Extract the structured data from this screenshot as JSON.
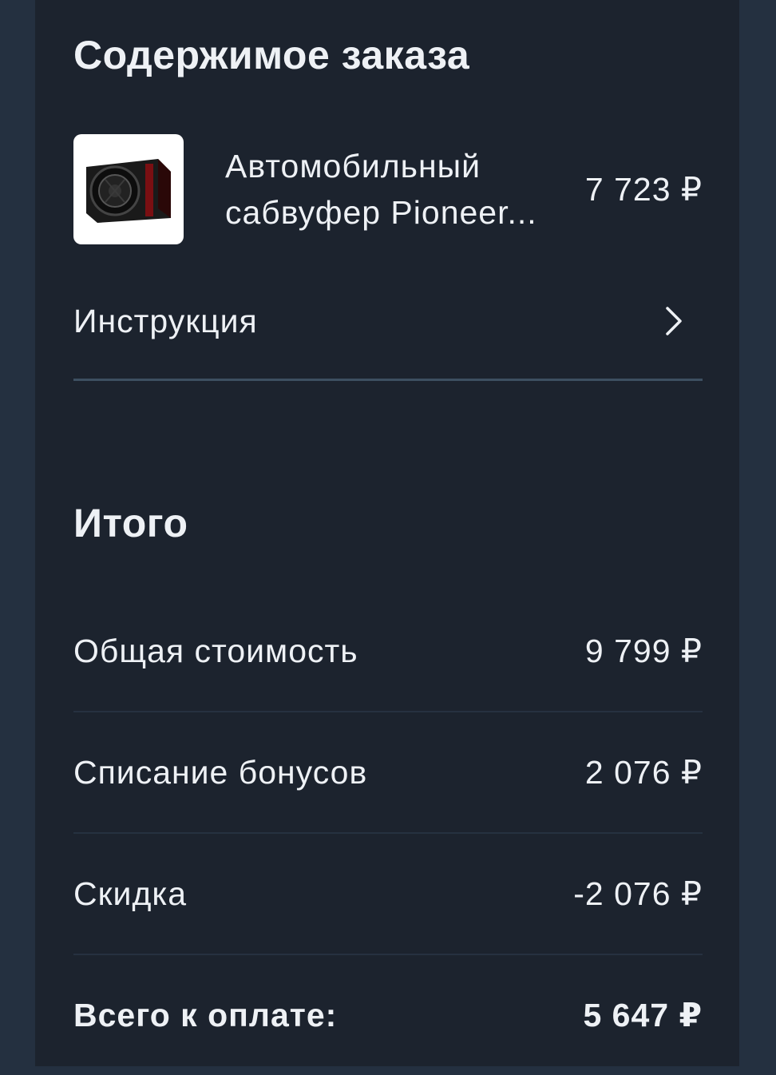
{
  "order": {
    "title": "Содержимое заказа",
    "item": {
      "name": "Автомобильный сабвуфер Pioneer...",
      "price": "7 723 ₽",
      "thumbnail_icon": "subwoofer-image"
    },
    "instruction_label": "Инструкция"
  },
  "totals": {
    "title": "Итого",
    "rows": [
      {
        "label": "Общая стоимость",
        "value": "9 799 ₽"
      },
      {
        "label": "Списание бонусов",
        "value": "2 076 ₽"
      },
      {
        "label": "Скидка",
        "value": "-2 076 ₽"
      },
      {
        "label": "Всего к оплате:",
        "value": "5 647 ₽"
      }
    ]
  },
  "colors": {
    "background": "#243040",
    "panel": "#1c232e",
    "text": "#eef1f5",
    "divider": "#3d4f61"
  }
}
